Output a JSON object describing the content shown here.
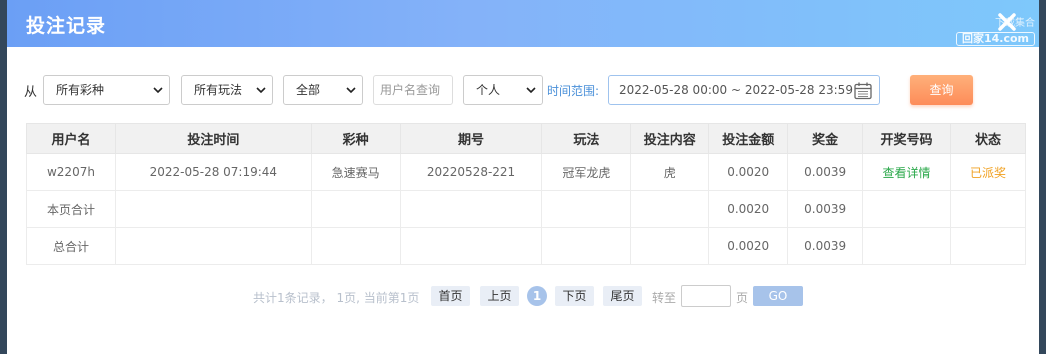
{
  "modal": {
    "title": "投注记录",
    "watermark_line1": "下载集合",
    "watermark_line2": "回家14.com"
  },
  "filters": {
    "from_label": "从",
    "lottery_select": "所有彩种",
    "play_select": "所有玩法",
    "status_select": "全部",
    "username_placeholder": "用户名查询",
    "scope_select": "个人",
    "range_label": "时间范围:",
    "date_range": "2022-05-28 00:00 ~ 2022-05-28 23:59",
    "query_label": "查询"
  },
  "table": {
    "headers": [
      "用户名",
      "投注时间",
      "彩种",
      "期号",
      "玩法",
      "投注内容",
      "投注金额",
      "奖金",
      "开奖号码",
      "状态"
    ],
    "record": {
      "username": "w2207h",
      "bet_time": "2022-05-28 07:19:44",
      "lottery": "急速赛马",
      "issue": "20220528-221",
      "play": "冠军龙虎",
      "content": "虎",
      "amount": "0.0020",
      "prize": "0.0039",
      "draw_link": "查看详情",
      "status": "已派奖"
    },
    "page_total": {
      "label": "本页合计",
      "amount": "0.0020",
      "prize": "0.0039"
    },
    "grand_total": {
      "label": "总合计",
      "amount": "0.0020",
      "prize": "0.0039"
    }
  },
  "pager": {
    "summary": "共计1条记录， 1页, 当前第1页",
    "first": "首页",
    "prev": "上页",
    "current": "1",
    "next": "下页",
    "last": "尾页",
    "goto_label": "转至",
    "page_unit": "页",
    "go_label": "GO"
  },
  "colors": {
    "header_gradient_start": "#6b9ff5",
    "header_gradient_end": "#7ec8fb",
    "query_button": "#fd8c59",
    "link_green": "#2aa84a",
    "status_gold": "#f0a020"
  }
}
